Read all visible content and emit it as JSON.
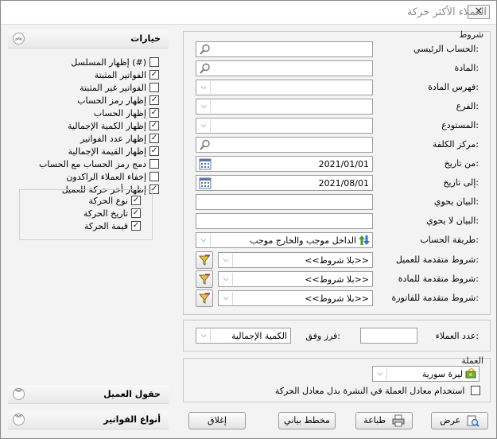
{
  "window": {
    "title": "العملاء الأكثر حركة",
    "close_glyph": "✕"
  },
  "conditions": {
    "legend": "شروط",
    "rows": [
      {
        "label": "الحساب الرئيسي:",
        "value": "",
        "kind": "search"
      },
      {
        "label": "المادة:",
        "value": "",
        "kind": "search"
      },
      {
        "label": "فهرس المادة:",
        "value": "",
        "kind": "combo"
      },
      {
        "label": "الفرع:",
        "value": "",
        "kind": "combo"
      },
      {
        "label": "المستودع:",
        "value": "",
        "kind": "combo"
      },
      {
        "label": "مركز الكلفة:",
        "value": "",
        "kind": "search"
      },
      {
        "label": "من تاريخ:",
        "value": "2021/01/01",
        "kind": "date"
      },
      {
        "label": "إلى تاريخ:",
        "value": "2021/08/01",
        "kind": "date"
      },
      {
        "label": "البيان يحوي:",
        "value": "",
        "kind": "text"
      },
      {
        "label": "البيان لا يحوي:",
        "value": "",
        "kind": "text"
      },
      {
        "label": "طريقة الحساب:",
        "value": "الداخل موجب والخارج موجب",
        "kind": "combo-icon"
      }
    ],
    "advanced": [
      {
        "label": "شروط متقدمة للعميل:",
        "value": "<<بلا شروط>>"
      },
      {
        "label": "شروط متقدمة للمادة:",
        "value": "<<بلا شروط>>"
      },
      {
        "label": "شروط متقدمة للفاتورة:",
        "value": "<<بلا شروط>>"
      }
    ]
  },
  "sort": {
    "count_label": "عدد العملاء:",
    "count_value": "",
    "sort_label": "فرز وفق:",
    "sort_value": "الكمية الإجمالية"
  },
  "currency": {
    "legend": "العملة",
    "value": "ليرة سورية",
    "equivalent_label": "استخدام معادل العملة في النشرة بدل معادل الحركة",
    "equivalent_checked": false
  },
  "buttons": {
    "show": "عرض",
    "print": "طباعة",
    "chart": "مخطط بياني",
    "close": "إغلاق"
  },
  "options_panel": {
    "title": "خيارات",
    "items": [
      {
        "label": "إظهار المسلسل (#)",
        "checked": false
      },
      {
        "label": "الفواتير المثبتة",
        "checked": true
      },
      {
        "label": "الفواتير غير المثبتة",
        "checked": false
      },
      {
        "label": "إظهار رمز الحساب",
        "checked": true
      },
      {
        "label": "إظهار الحساب",
        "checked": true
      },
      {
        "label": "إظهار الكمية الإجمالية",
        "checked": true
      },
      {
        "label": "إظهار عدد الفواتير",
        "checked": true
      },
      {
        "label": "إظهار القيمة الإجمالية",
        "checked": true
      },
      {
        "label": "دمج رمز الحساب مع الحساب",
        "checked": false
      },
      {
        "label": "إخفاء العملاء الراكدون",
        "checked": false
      },
      {
        "label": "إظهار أخر حركة للعميل",
        "checked": true
      }
    ],
    "sub_items": [
      {
        "label": "نوع الحركة",
        "checked": true
      },
      {
        "label": "تاريخ الحركة",
        "checked": true
      },
      {
        "label": "قيمة الحركة",
        "checked": true
      }
    ]
  },
  "customer_fields": {
    "title": "حقول العميل"
  },
  "invoice_types": {
    "title": "أنواع الفواتير"
  },
  "icons": {
    "search": "magnifier-icon",
    "calendar": "calendar-icon",
    "filter": "filter-icon",
    "collapse_up": "double-chevron-up-icon",
    "expand_down": "double-chevron-down-icon"
  },
  "colors": {
    "window_bg": "#f3f3f3",
    "field_border": "#9c9c9c",
    "title_text": "#8a8a8a"
  }
}
